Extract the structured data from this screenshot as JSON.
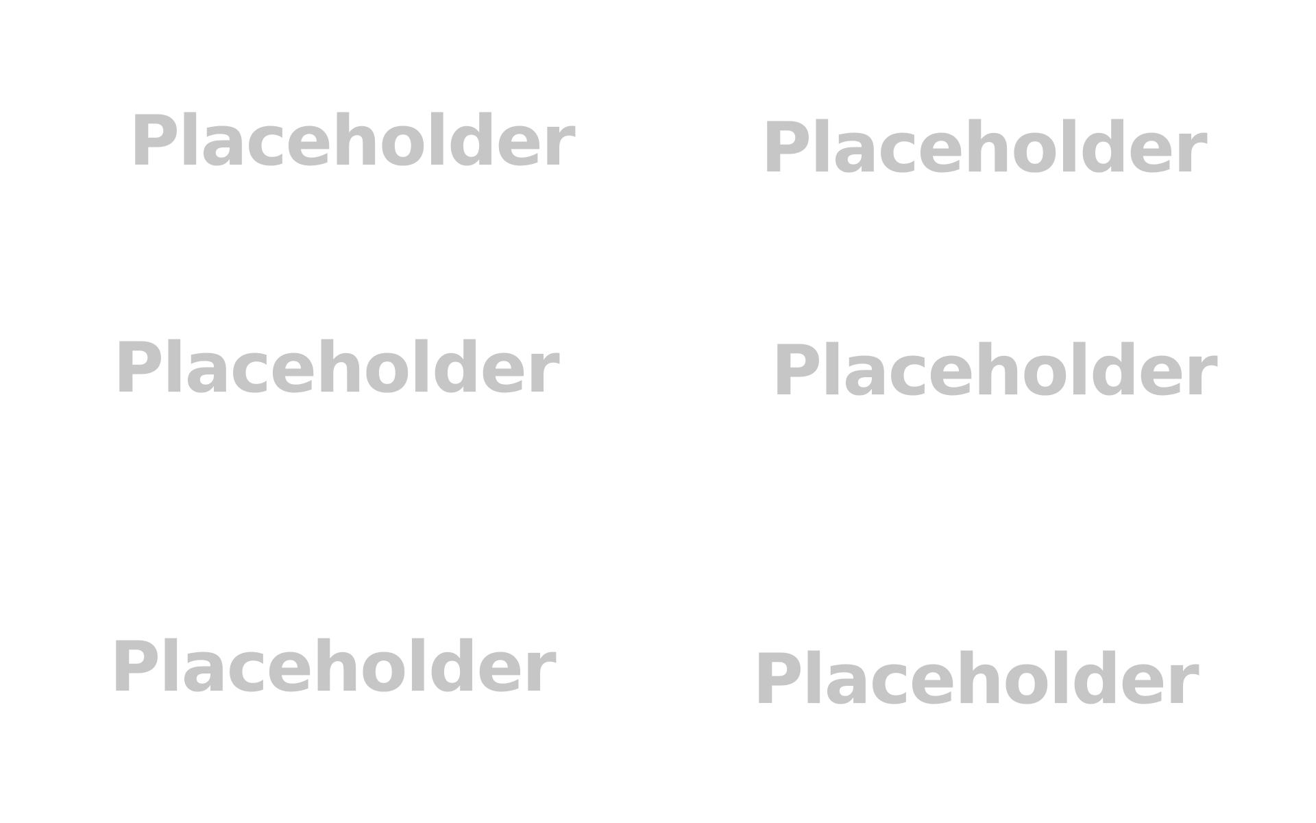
{
  "colors": {
    "background": "#ffffff",
    "placeholder_text": "#c6c6c6"
  },
  "placeholders": [
    {
      "text": "Placeholder"
    },
    {
      "text": "Placeholder"
    },
    {
      "text": "Placeholder"
    },
    {
      "text": "Placeholder"
    },
    {
      "text": "Placeholder"
    },
    {
      "text": "Placeholder"
    }
  ]
}
